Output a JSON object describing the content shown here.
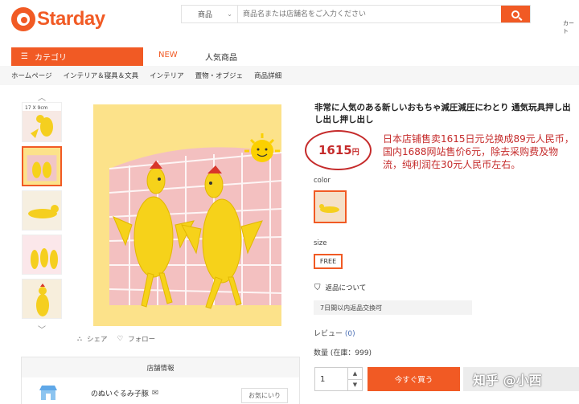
{
  "header": {
    "logo_text": "Starday",
    "search_category": "商品",
    "search_placeholder": "商品名または店舗名をご入力ください",
    "cart_label": "カート"
  },
  "nav": {
    "category_label": "カテゴリ",
    "new_label": "NEW",
    "popular_label": "人気商品"
  },
  "breadcrumb": [
    "ホームページ",
    "インテリア＆寝具＆文具",
    "インテリア",
    "置物・オブジェ",
    "商品詳細"
  ],
  "gallery": {
    "share_label": "シェア",
    "follow_label": "フォロー",
    "thumb_count_text": "17 X 9cm"
  },
  "shop": {
    "header": "店舗情報",
    "name": "のぬいぐるみ子豚",
    "favorite_label": "お気にいり"
  },
  "product": {
    "title": "非常に人気のある新しいおもちゃ減圧減圧にわとり 通気玩具押し出し出し押し出し",
    "price": "1615",
    "price_unit": "円",
    "annotation": "日本店铺售卖1615日元兑换成89元人民币，国内1688网站售价6元，除去采购费及物流，纯利润在30元人民币左右。",
    "color_label": "color",
    "size_label": "size",
    "size_value": "FREE",
    "return_label": "返品について",
    "return_policy": "7日間以内返品交換可",
    "review_label": "レビュー",
    "review_count": "(0)",
    "stock_label": "数量 (在庫：999)",
    "quantity": "1",
    "buy_label": "今すぐ買う"
  },
  "watermark": "知乎 @小西",
  "colors": {
    "accent": "#f15a24",
    "annotation_red": "#c52b2b",
    "image_bg": "#fce28a"
  }
}
